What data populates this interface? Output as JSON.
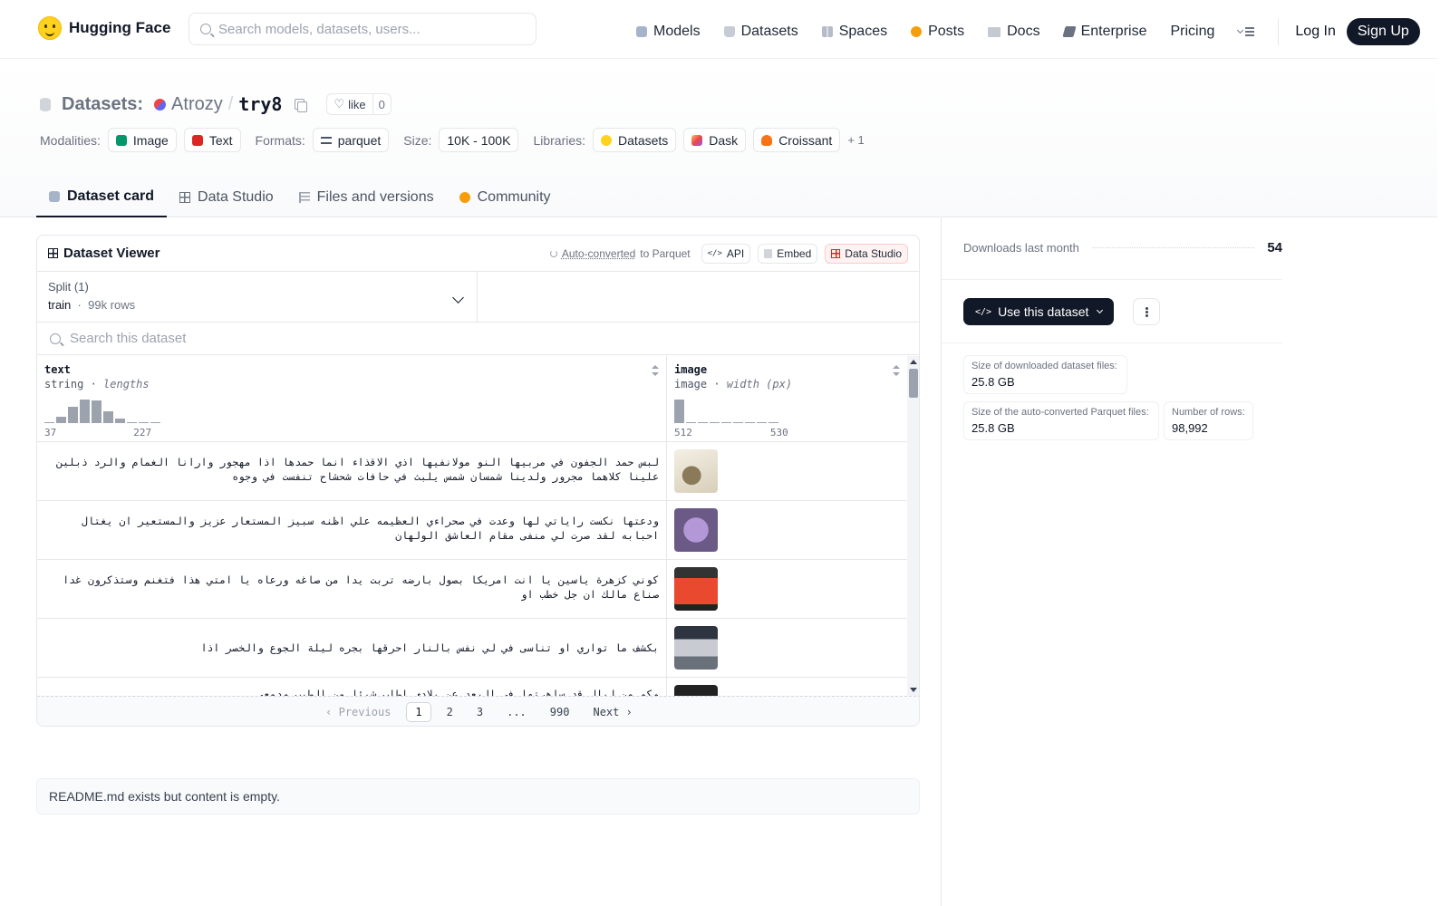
{
  "nav": {
    "brand": "Hugging Face",
    "search_placeholder": "Search models, datasets, users...",
    "links": [
      {
        "label": "Models",
        "icon": "cube-icon"
      },
      {
        "label": "Datasets",
        "icon": "database-icon"
      },
      {
        "label": "Spaces",
        "icon": "grid-icon"
      },
      {
        "label": "Posts",
        "icon": "posts-icon"
      },
      {
        "label": "Docs",
        "icon": "book-icon"
      },
      {
        "label": "Enterprise",
        "icon": "enterprise-icon"
      },
      {
        "label": "Pricing"
      }
    ],
    "login": "Log In",
    "signup": "Sign Up"
  },
  "header": {
    "kind": "Datasets:",
    "owner": "Atrozy",
    "slash": "/",
    "name": "try8",
    "like_label": "like",
    "like_count": "0",
    "modalities_label": "Modalities:",
    "modalities": [
      "Image",
      "Text"
    ],
    "formats_label": "Formats:",
    "formats": [
      "parquet"
    ],
    "size_label": "Size:",
    "size": "10K - 100K",
    "libraries_label": "Libraries:",
    "libraries": [
      "Datasets",
      "Dask",
      "Croissant"
    ],
    "libraries_more": "+ 1"
  },
  "tabs": [
    "Dataset card",
    "Data Studio",
    "Files and versions",
    "Community"
  ],
  "viewer": {
    "title": "Dataset Viewer",
    "auto_converted": "Auto-converted",
    "to_parquet": "to Parquet",
    "api": "API",
    "embed": "Embed",
    "data_studio": "Data Studio",
    "split_label": "Split (1)",
    "split_name": "train",
    "split_sep": "·",
    "split_rows": "99k rows",
    "search_placeholder": "Search this dataset",
    "columns": [
      {
        "name": "text",
        "type": "string",
        "stat": "lengths",
        "min": "37",
        "max": "227",
        "hist": [
          0.05,
          0.25,
          0.7,
          1.0,
          0.95,
          0.5,
          0.2,
          0.05,
          0.05,
          0.05
        ]
      },
      {
        "name": "image",
        "type": "image",
        "stat": "width (px)",
        "min": "512",
        "max": "530",
        "hist": [
          1.0,
          0.05,
          0.05,
          0.05,
          0.05,
          0.05,
          0.05,
          0.05,
          0.05
        ]
      }
    ],
    "rows": [
      {
        "text": "لبس حمد الجفون في مربيها النو مولانفيها اذي الاقذاء انما حمدها اذا مهجور وارانا الغمام والرد ذبلين علينا كلاهما مجرور ولدينا شمسان شمس يلبث في حافات شحشاح تنفست في وجوه",
        "thumb": "th1"
      },
      {
        "text": "ودعتها نكست راياتي لها وعدت في صحراءي العظيمه علي اظنه سبيز المستعار عزيز والمستعير ان يغتال احبابه لقد صرت لي منفى مقام العاشق الولهان",
        "thumb": "th2"
      },
      {
        "text": "كوني كزهرة ياسين يا انت امريكا بصول بارضه تربت يدا من صاغه ورعاه يا امتي هذا فتغنم وستذكرون غدا صناع مالك ان جل خطب او",
        "thumb": "th3"
      },
      {
        "text": "بكشف ما تواري او تناسى في لي نفس بالنار احرقها بجره ليلة الجوع والخصر اذا",
        "thumb": "th4"
      },
      {
        "text": "وكم من ليال قد ساهرتها في البعد عن بلادي اطلب شيئا من الطيب ودمعي",
        "thumb": "th5"
      }
    ],
    "pager": {
      "prev": "Previous",
      "pages": [
        "1",
        "2",
        "3",
        "...",
        "990"
      ],
      "next": "Next"
    }
  },
  "readme": "README.md exists but content is empty.",
  "sidebar": {
    "downloads_label": "Downloads last month",
    "downloads": "54",
    "use_button": "Use this dataset",
    "stats": [
      {
        "label": "Size of downloaded dataset files:",
        "value": "25.8 GB"
      },
      {
        "label": "Size of the auto-converted Parquet files:",
        "value": "25.8 GB"
      },
      {
        "label": "Number of rows:",
        "value": "98,992"
      }
    ]
  }
}
